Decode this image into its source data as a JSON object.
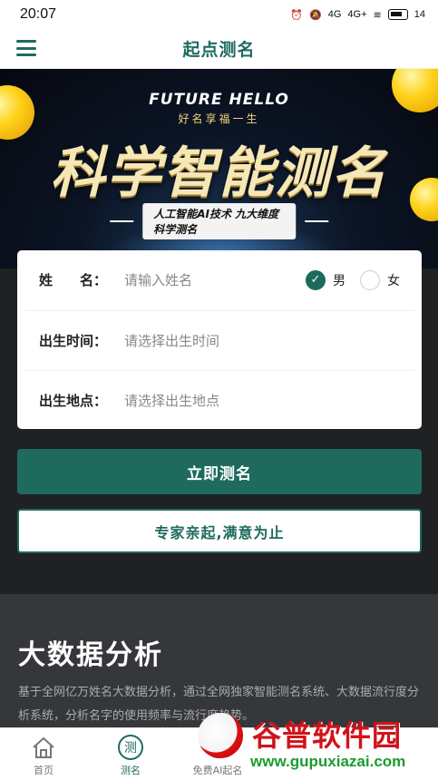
{
  "status": {
    "time": "20:07",
    "network_a": "4G",
    "network_b": "4G+",
    "battery": "14"
  },
  "header": {
    "title": "起点测名"
  },
  "hero": {
    "en_title": "FUTURE HELLO",
    "cn_sub": "好名享福一生",
    "main_title": "科学智能测名",
    "tagline": "人工智能AI技术 九大维度科学测名"
  },
  "form": {
    "name_label": "姓　　名：",
    "name_placeholder": "请输入姓名",
    "gender_male": "男",
    "gender_female": "女",
    "gender_selected": "男",
    "birth_time_label": "出生时间：",
    "birth_time_placeholder": "请选择出生时间",
    "birth_place_label": "出生地点：",
    "birth_place_placeholder": "请选择出生地点"
  },
  "actions": {
    "primary": "立即测名",
    "secondary": "专家亲起,满意为止"
  },
  "data_section": {
    "heading": "大数据分析",
    "text": "基于全网亿万姓名大数据分析，通过全网独家智能测名系统、大数据流行度分析系统，分析名字的使用频率与流行度趋势。"
  },
  "tabs": [
    {
      "label": "首页",
      "icon": "home-icon"
    },
    {
      "label": "测名",
      "icon": "measure-name-icon",
      "active": true
    },
    {
      "label": "免费AI起名",
      "icon": "ai-icon"
    }
  ],
  "watermark": {
    "name": "谷普软件园",
    "url": "www.gupuxiazai.com"
  },
  "colors": {
    "accent": "#1e6b5e",
    "page_bg": "#1f2122"
  }
}
